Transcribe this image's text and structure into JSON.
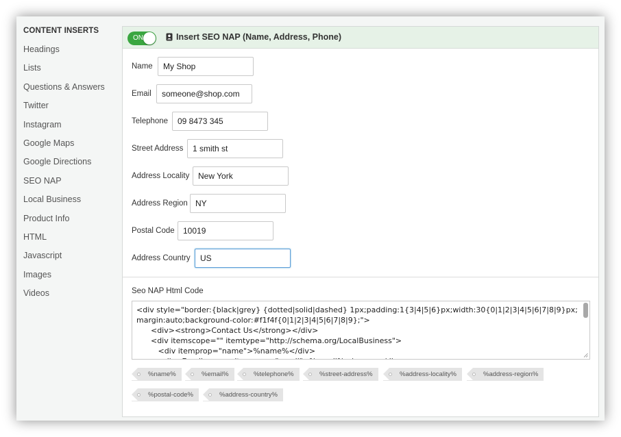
{
  "sidebar": {
    "header": "CONTENT INSERTS",
    "items": [
      {
        "label": "Headings"
      },
      {
        "label": "Lists"
      },
      {
        "label": "Questions & Answers"
      },
      {
        "label": "Twitter"
      },
      {
        "label": "Instagram"
      },
      {
        "label": "Google Maps"
      },
      {
        "label": "Google Directions"
      },
      {
        "label": "SEO NAP"
      },
      {
        "label": "Local Business"
      },
      {
        "label": "Product Info"
      },
      {
        "label": "HTML"
      },
      {
        "label": "Javascript"
      },
      {
        "label": "Images"
      },
      {
        "label": "Videos"
      }
    ]
  },
  "panel": {
    "toggle_label": "ON",
    "icon": "contact-card-icon",
    "title": "Insert SEO NAP (Name, Address, Phone)"
  },
  "form": {
    "fields": [
      {
        "label": "Name",
        "value": "My Shop"
      },
      {
        "label": "Email",
        "value": "someone@shop.com"
      },
      {
        "label": "Telephone",
        "value": "09 8473 345"
      },
      {
        "label": "Street Address",
        "value": "1 smith st"
      },
      {
        "label": "Address Locality",
        "value": "New York"
      },
      {
        "label": "Address Region",
        "value": "NY"
      },
      {
        "label": "Postal Code",
        "value": "10019"
      },
      {
        "label": "Address Country",
        "value": "US"
      }
    ]
  },
  "code": {
    "label": "Seo NAP Html Code",
    "text": "<div style=\"border:{black|grey} {dotted|solid|dashed} 1px;padding:1{3|4|5|6}px;width:30{0|1|2|3|4|5|6|7|8|9}px;margin:auto;background-color:#f1f4f{0|1|2|3|4|5|6|7|8|9};\">\n      <div><strong>Contact Us</strong></div>\n      <div itemscope=\"\" itemtype=\"http://schema.org/LocalBusiness\">\n         <div itemprop=\"name\">%name%</div>\n         <div>Email: <span itemprop=\"email\">%email%</span></div>"
  },
  "tags": [
    "%name%",
    "%email%",
    "%telephone%",
    "%street-address%",
    "%address-locality%",
    "%address-region%",
    "%postal-code%",
    "%address-country%"
  ],
  "colors": {
    "toggle_on": "#3aa640",
    "header_bg": "#e6f2e7",
    "sidebar_bg": "#f4f6f5",
    "focus_border": "#5b9dd9",
    "tag_bg": "#e4e4e4"
  }
}
